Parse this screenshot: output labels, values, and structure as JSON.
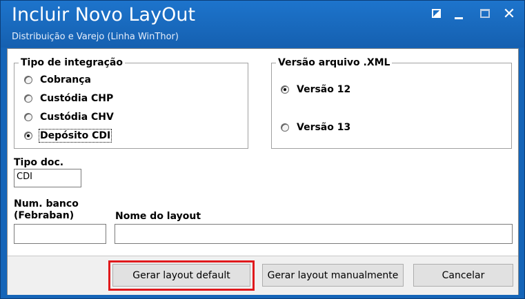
{
  "window": {
    "title": "Incluir Novo LayOut",
    "subtitle": "Distribuição e Varejo (Linha WinThor)",
    "controls": [
      "restore-icon",
      "minimize-icon",
      "maximize-icon",
      "close-icon"
    ],
    "close_glyph": "✕"
  },
  "tipo_integracao": {
    "title": "Tipo de integração",
    "options": [
      {
        "label": "Cobrança",
        "checked": false
      },
      {
        "label": "Custódia CHP",
        "checked": false
      },
      {
        "label": "Custódia CHV",
        "checked": false
      },
      {
        "label": "Depósito CDI",
        "checked": true
      }
    ]
  },
  "versao_xml": {
    "title": "Versão arquivo .XML",
    "options": [
      {
        "label": "Versão 12",
        "checked": true
      },
      {
        "label": "Versão 13",
        "checked": false
      }
    ]
  },
  "tipo_doc": {
    "label": "Tipo doc.",
    "value": "CDI"
  },
  "num_banco": {
    "label_line1": "Num. banco",
    "label_line2": "(Febraban)",
    "value": ""
  },
  "nome_layout": {
    "label": "Nome do layout",
    "value": ""
  },
  "buttons": {
    "gerar_default": "Gerar layout default",
    "gerar_manual": "Gerar layout manualmente",
    "cancelar": "Cancelar"
  },
  "colors": {
    "titlebar": "#1565b8",
    "highlight": "#e0191c"
  }
}
